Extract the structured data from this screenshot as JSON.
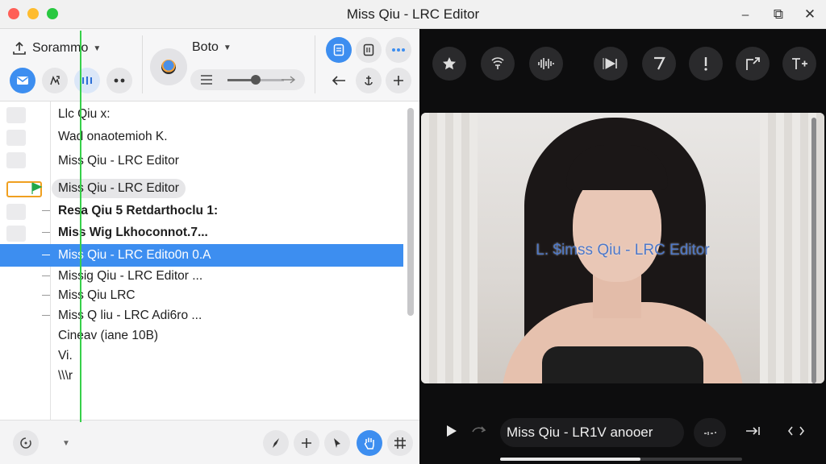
{
  "window": {
    "title": "Miss Qiu - LRC Editor",
    "minimize_glyph": "⎯",
    "maximize_glyph": "⧉",
    "close_glyph": "✕"
  },
  "toolbar": {
    "source_select": "Sorammo",
    "profile_select": "Boto",
    "slider_level": 0.5
  },
  "lyrics": {
    "lines": [
      "Llc Qiu x:",
      "Wad onaotemioh K.",
      "Miss Qiu - LRC Editor",
      "Miss Qiu - LRC Editor",
      "Resa Qiu  5 Retdarthoclu 1:",
      "Miss Wig Lkhoconnot.7...",
      "Miss Qiu - LRC Edito0n 0.A",
      "Missig Qiu - LRC Editor ...",
      "Miss Qiu LRC",
      "Miss Q liu - LRC Adi6ro ...",
      "Cineav (iane 10B)",
      "Vi.",
      "\\\\\\r"
    ],
    "selected_index": 6
  },
  "player": {
    "caption": "L. $imss Qiu - LRC Editor",
    "now_playing": "Miss Qiu - LR1V anooer",
    "progress": 0.58
  },
  "colors": {
    "accent": "#3d8ef0",
    "playhead": "#37d04a",
    "flag": "#22a84a",
    "selection_outline": "#f0a020"
  }
}
